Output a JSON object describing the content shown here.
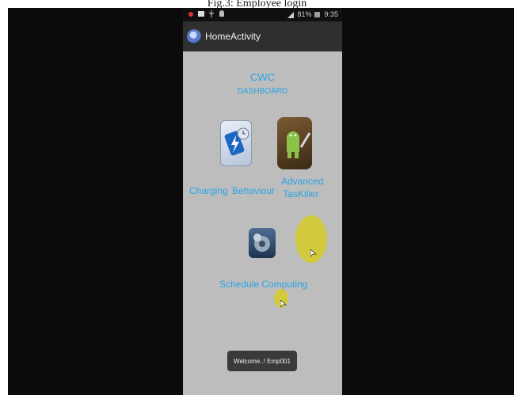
{
  "caption": "Fig.3: Employee login",
  "statusbar": {
    "left_icons": [
      "notification-icon",
      "image-icon",
      "usb-icon",
      "android-icon"
    ],
    "signal_text": "81%",
    "time": "9:35"
  },
  "actionbar": {
    "title": "HomeActivity",
    "icon": "app-globe-icon"
  },
  "dashboard": {
    "title": "CWC",
    "subtitle": "DASHBOARD"
  },
  "apps": {
    "charging_label": "Charging",
    "behaviour_label": "Behaviour",
    "advanced_label_1": "Advanced",
    "advanced_label_2": "TasKiller",
    "schedule_label": "Schedule Computing",
    "icons": [
      "battery-icon",
      "android-taskkiller-icon",
      "gears-icon"
    ]
  },
  "toast": {
    "text": "Welcome..! Emp001"
  },
  "colors": {
    "accent_text": "#2aa4e6",
    "screen_bg": "#bdbdbd",
    "actionbar_bg": "#2f2f2f",
    "touch_indicator": "#d6cc28"
  }
}
